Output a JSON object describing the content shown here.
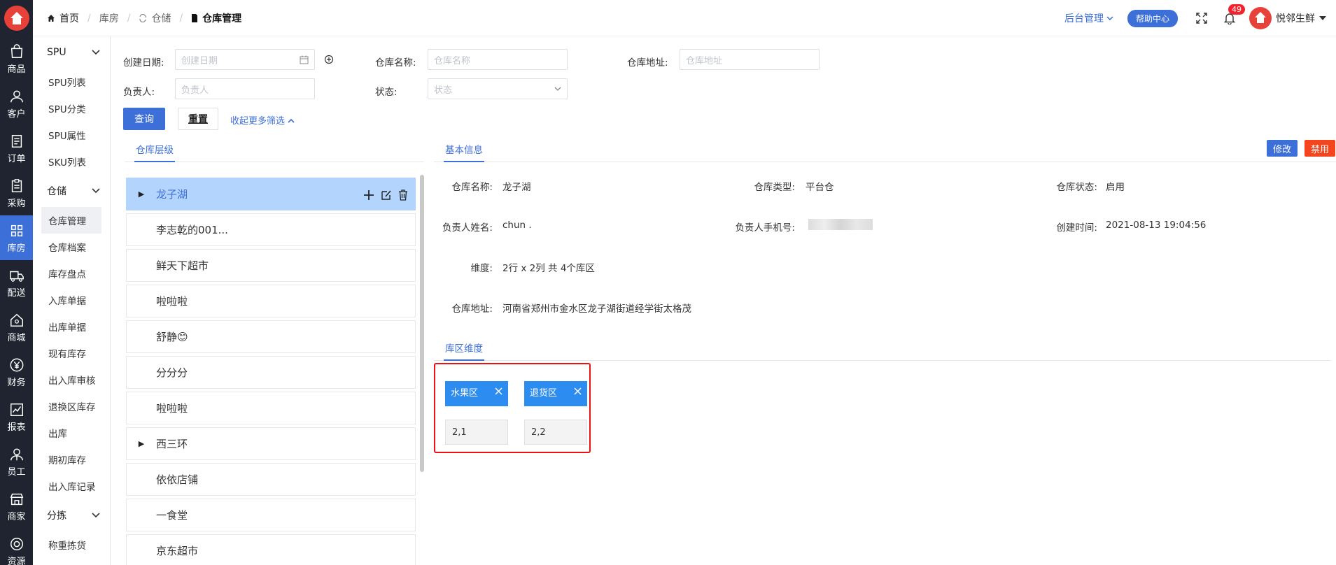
{
  "rail": {
    "items": [
      {
        "label": "商品",
        "icon": "bag-icon"
      },
      {
        "label": "客户",
        "icon": "user-icon"
      },
      {
        "label": "订单",
        "icon": "order-icon"
      },
      {
        "label": "采购",
        "icon": "clipboard-icon"
      },
      {
        "label": "库房",
        "icon": "warehouse-icon"
      },
      {
        "label": "配送",
        "icon": "truck-icon"
      },
      {
        "label": "商城",
        "icon": "home-icon"
      },
      {
        "label": "财务",
        "icon": "yen-icon"
      },
      {
        "label": "报表",
        "icon": "chart-icon"
      },
      {
        "label": "员工",
        "icon": "staff-icon"
      },
      {
        "label": "商家",
        "icon": "shop-icon"
      },
      {
        "label": "资源",
        "icon": "settings-icon"
      }
    ],
    "active_index": 4
  },
  "submenu": {
    "groups": [
      {
        "label": "SPU",
        "items": [
          "SPU列表",
          "SPU分类",
          "SPU属性",
          "SKU列表"
        ]
      },
      {
        "label": "仓储",
        "items": [
          "仓库管理",
          "仓库档案",
          "库存盘点",
          "入库单据",
          "出库单据",
          "现有库存",
          "出入库审核",
          "退换区库存",
          "出库",
          "期初库存",
          "出入库记录"
        ]
      },
      {
        "label": "分拣",
        "items": [
          "称重拣货"
        ]
      }
    ],
    "active_item": "仓库管理"
  },
  "breadcrumb": {
    "home": "首页",
    "level1": "库房",
    "level2": "仓储",
    "current": "仓库管理"
  },
  "header": {
    "admin_label": "后台管理",
    "help_label": "帮助中心",
    "notification_count": "49",
    "user_name": "悦邻生鲜"
  },
  "filters": {
    "date_label": "创建日期:",
    "date_placeholder": "创建日期",
    "name_label": "仓库名称:",
    "name_placeholder": "仓库名称",
    "address_label": "仓库地址:",
    "address_placeholder": "仓库地址",
    "owner_label": "负责人:",
    "owner_placeholder": "负责人",
    "status_label": "状态:",
    "status_placeholder": "状态",
    "query_button": "查询",
    "reset_button": "重置",
    "toggle_more": "收起更多筛选"
  },
  "tree": {
    "tab": "仓库层级",
    "nodes": [
      {
        "label": "龙子湖",
        "expandable": true,
        "selected": true
      },
      {
        "label": "李志乾的001...",
        "expandable": false,
        "selected": false
      },
      {
        "label": "鲜天下超市",
        "expandable": false,
        "selected": false
      },
      {
        "label": "啦啦啦",
        "expandable": false,
        "selected": false
      },
      {
        "label": "舒静😊",
        "expandable": false,
        "selected": false
      },
      {
        "label": "分分分",
        "expandable": false,
        "selected": false
      },
      {
        "label": "啦啦啦",
        "expandable": false,
        "selected": false
      },
      {
        "label": "西三环",
        "expandable": true,
        "selected": false
      },
      {
        "label": "依依店铺",
        "expandable": false,
        "selected": false
      },
      {
        "label": "一食堂",
        "expandable": false,
        "selected": false
      },
      {
        "label": "京东超市",
        "expandable": false,
        "selected": false
      }
    ]
  },
  "detail": {
    "tab": "基本信息",
    "edit_button": "修改",
    "disable_button": "禁用",
    "name_label": "仓库名称:",
    "name_value": "龙子湖",
    "type_label": "仓库类型:",
    "type_value": "平台仓",
    "status_label": "仓库状态:",
    "status_value": "启用",
    "owner_label": "负责人姓名:",
    "owner_value": "chun .",
    "phone_label": "负责人手机号:",
    "created_label": "创建时间:",
    "created_value": "2021-08-13 19:04:56",
    "dimension_label": "维度:",
    "dimension_value": "2行 x 2列 共 4个库区",
    "address_label": "仓库地址:",
    "address_value": "河南省郑州市金水区龙子湖街道经学街太格茂"
  },
  "zones": {
    "tab": "库区维度",
    "items": [
      {
        "name": "水果区",
        "value": "2,1"
      },
      {
        "name": "退货区",
        "value": "2,2"
      }
    ]
  },
  "colors": {
    "primary": "#3d6fd8",
    "danger": "#f5222d",
    "rail_bg": "#1f2430",
    "selected_bg": "#b3d4fc",
    "zone_tag": "#2d8cf0",
    "highlight_border": "#e11111"
  }
}
